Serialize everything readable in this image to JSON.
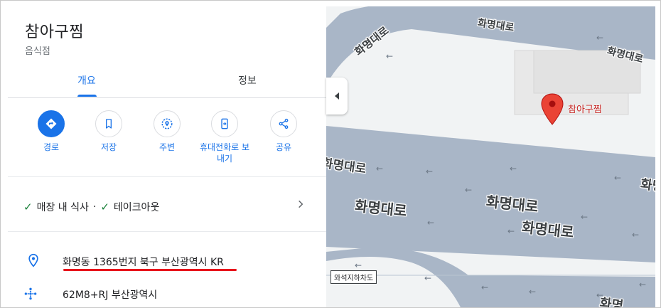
{
  "place": {
    "name": "참아구찜",
    "category": "음식점"
  },
  "tabs": [
    {
      "label": "개요",
      "active": true
    },
    {
      "label": "정보",
      "active": false
    }
  ],
  "actions": [
    {
      "label": "경로",
      "icon": "directions-icon"
    },
    {
      "label": "저장",
      "icon": "bookmark-icon"
    },
    {
      "label": "주변",
      "icon": "nearby-icon"
    },
    {
      "label_line1": "휴대전화로 보",
      "label_line2": "내기",
      "icon": "send-to-phone-icon"
    },
    {
      "label": "공유",
      "icon": "share-icon"
    }
  ],
  "features": {
    "dine_in": "매장 내 식사",
    "separator": "·",
    "takeout": "테이크아웃"
  },
  "address": "화명동 1365번지 북구 부산광역시 KR",
  "plus_code": "62M8+RJ 부산광역시",
  "map": {
    "place_label": "참아구찜",
    "road_labels": [
      "화명대로",
      "화명대로",
      "화명대로",
      "화명대로",
      "화명대로",
      "화명대로",
      "화명대로",
      "화명대로",
      "화명"
    ],
    "underpass_label": "와석지하차도"
  },
  "colors": {
    "accent": "#1a73e8",
    "check": "#188038",
    "highlight_underline": "#e8141b",
    "road": "#a9b6c7",
    "marker": "#ea4335"
  }
}
